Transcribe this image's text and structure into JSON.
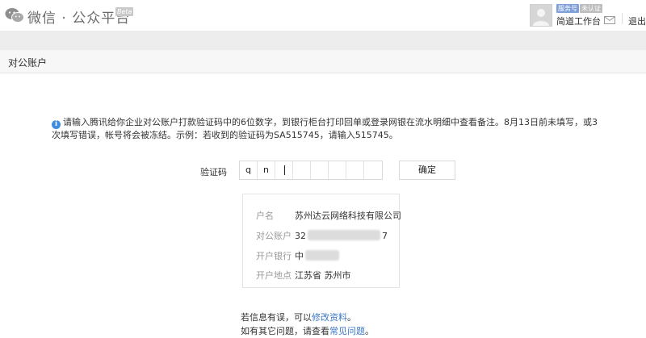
{
  "header": {
    "logo_text": "微信 · 公众平台",
    "beta_label": "Beta",
    "account_tags": {
      "service": "服务号",
      "unverified": "未认证"
    },
    "workbench_label": "简道工作台",
    "logout_label": "退出"
  },
  "section": {
    "title": "对公账户"
  },
  "notice": {
    "text": "请输入腾讯给你企业对公账户打款验证码中的6位数字，到银行柜台打印回单或登录网银在流水明细中查看备注。8月13日前未填写，或3次填写错误，帐号将会被冻结。示例：若收到的验证码为SA515745，请输入515745。"
  },
  "verification": {
    "label": "验证码",
    "chars": [
      "q",
      "n",
      "",
      "",
      "",
      "",
      "",
      ""
    ],
    "confirm_label": "确定"
  },
  "account_info": {
    "rows": [
      {
        "key": "户名",
        "value": "苏州达云网络科技有限公司"
      },
      {
        "key": "对公账户",
        "value_prefix": "32",
        "value_suffix": "7"
      },
      {
        "key": "开户银行",
        "value_prefix": "中"
      },
      {
        "key": "开户地点",
        "value": "江苏省 苏州市"
      }
    ]
  },
  "footer": {
    "line1_prefix": "若信息有误，可以",
    "line1_link": "修改资料",
    "line1_suffix": "。",
    "line2_prefix": "如有其它问题，请查看",
    "line2_link": "常见问题",
    "line2_suffix": "。"
  },
  "colors": {
    "accent": "#3e8de0",
    "link": "#3b76c4",
    "service_tag": "#7f9fd8"
  },
  "icons": [
    "wechat-logo-icon",
    "mail-icon",
    "info-icon"
  ]
}
